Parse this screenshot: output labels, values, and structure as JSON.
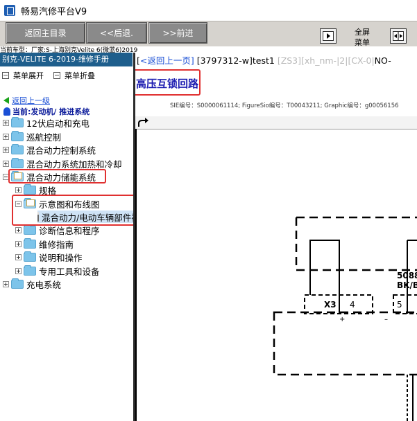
{
  "window": {
    "title": "畅易汽修平台V9"
  },
  "toolbar": {
    "home_label": "返回主目录",
    "back_label": "<<后退.",
    "forward_label": ">>前进",
    "fullscreen_label_line1": "全屏",
    "fullscreen_label_line2": "菜单"
  },
  "vehicle_line": "当前车型：厂家:S-上海别克Velite 6(微蓝6)2019",
  "left": {
    "header": "别克-VELITE 6-2019-维修手册",
    "expand_label": "菜单展开",
    "collapse_label": "菜单折叠",
    "back_link": "返回上一级",
    "current": "当前:发动机/ 推进系统",
    "tree": [
      {
        "label": "12伏启动和充电"
      },
      {
        "label": "巡航控制"
      },
      {
        "label": "混合动力控制系统"
      },
      {
        "label": "混合动力系统加热和冷却"
      },
      {
        "label": "混合动力储能系统"
      },
      {
        "label": "规格"
      },
      {
        "label": "示意图和布线图"
      },
      {
        "label": "混合动力/电动车辆部件视图"
      },
      {
        "label": "诊断信息和程序"
      },
      {
        "label": "维修指南"
      },
      {
        "label": "说明和操作"
      },
      {
        "label": "专用工具和设备"
      },
      {
        "label": "充电系统"
      }
    ]
  },
  "right": {
    "breadcrumb_link": "<返回上一页]",
    "breadcrumb_open": "[",
    "breadcrumb_id": " [3797312-w]test1 ",
    "breadcrumb_gray": "[ZS3][xh_nm-|2|[CX-0|",
    "breadcrumb_tail": "NO-",
    "title": "高压互锁回路",
    "ids": "SIE编号：S0000061114;  FigureSio编号：T00043211;  Graphic编号：g00056156"
  },
  "diagram": {
    "connector": "X3",
    "pin_a": "4",
    "pin_b": "5",
    "wire_code": "5088",
    "wire_color": "BK/B",
    "plus": "+",
    "minus": "–"
  }
}
